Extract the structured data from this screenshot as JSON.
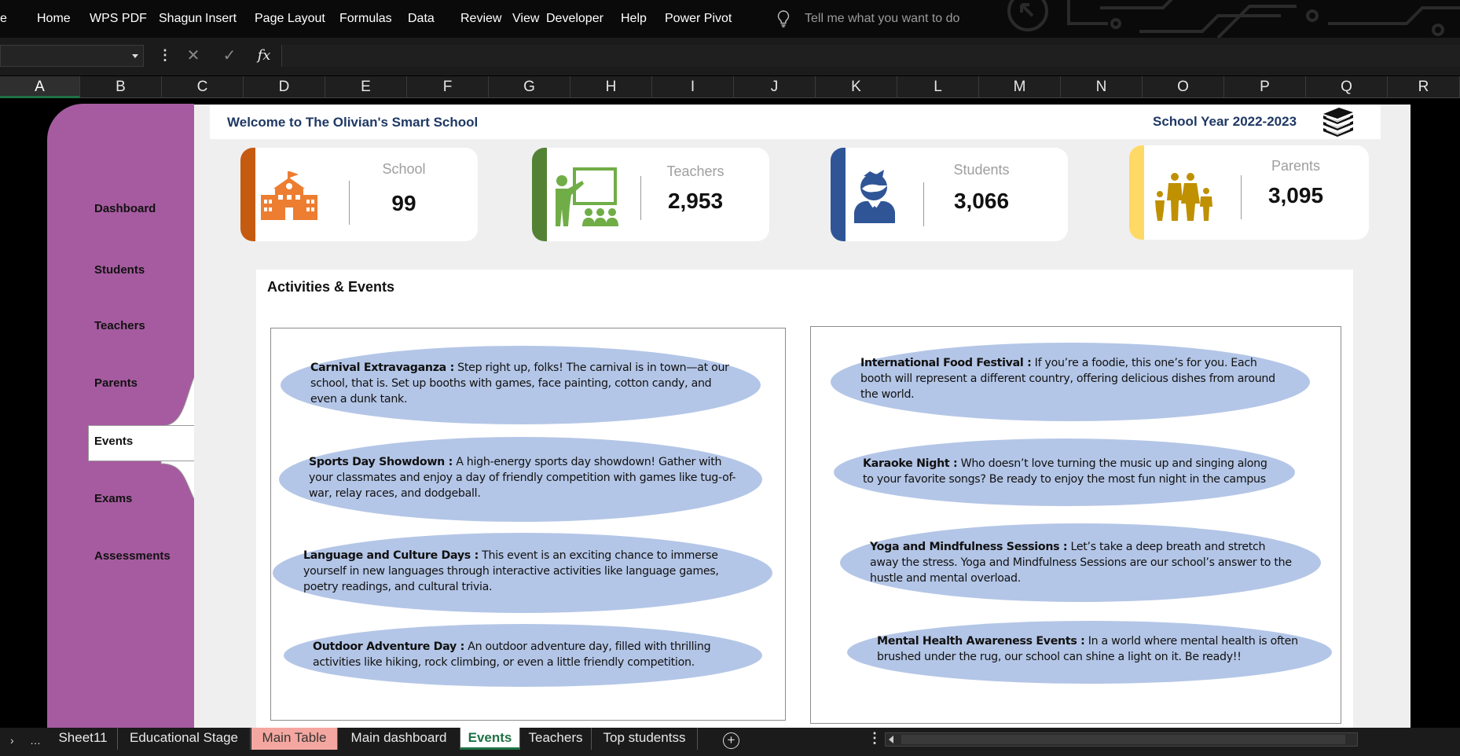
{
  "ribbon": {
    "menu": [
      "e",
      "Home",
      "WPS PDF",
      "Shagun",
      "Insert",
      "Page Layout",
      "Formulas",
      "Data",
      "Review",
      "View",
      "Developer",
      "Help",
      "Power Pivot"
    ],
    "tell_me": "Tell me what you want to do"
  },
  "formula_bar": {
    "cancel": "✕",
    "enter": "✓",
    "fx": "fx"
  },
  "columns": [
    "A",
    "B",
    "C",
    "D",
    "E",
    "F",
    "G",
    "H",
    "I",
    "J",
    "K",
    "L",
    "M",
    "N",
    "O",
    "P",
    "Q",
    "R"
  ],
  "selected_column": "A",
  "sidebar": {
    "items": [
      "Dashboard",
      "Students",
      "Teachers",
      "Parents",
      "Events",
      "Exams",
      "Assessments"
    ],
    "active": "Events"
  },
  "header": {
    "welcome": "Welcome to The Olivian's Smart School",
    "year": "School Year 2022-2023"
  },
  "cards": [
    {
      "label": "School",
      "value": "99",
      "color": "#c55a11",
      "icon": "school-building-icon"
    },
    {
      "label": "Teachers",
      "value": "2,953",
      "color": "#548235",
      "icon": "teacher-board-icon"
    },
    {
      "label": "Students",
      "value": "3,066",
      "color": "#2f5597",
      "icon": "student-icon"
    },
    {
      "label": "Parents",
      "value": "3,095",
      "color": "#ffd966",
      "icon": "family-icon"
    }
  ],
  "events": {
    "heading": "Activities & Events",
    "left": [
      {
        "title": "Carnival Extravaganza :",
        "text": " Step right up, folks! The carnival is in town—at our school, that is. Set up booths with games, face painting, cotton candy, and even a dunk tank."
      },
      {
        "title": "Sports Day Showdown :",
        "text": " A high-energy sports day showdown! Gather with your classmates and enjoy a day of friendly competition with games like tug-of-war, relay races, and dodgeball."
      },
      {
        "title": "Language and Culture Days :",
        "text": " This event is an exciting chance to immerse yourself in new languages through interactive activities like language games, poetry readings, and cultural trivia."
      },
      {
        "title": "Outdoor Adventure Day :",
        "text": " An outdoor adventure day, filled with thrilling activities like hiking, rock climbing, or even a little friendly competition."
      }
    ],
    "right": [
      {
        "title": "International Food Festival :",
        "text": " If you’re a foodie, this one’s for you. Each booth will represent a different country, offering delicious dishes from around the world."
      },
      {
        "title": "Karaoke Night :",
        "text": " Who doesn’t love turning the music up and singing along to your favorite songs? Be ready to enjoy the most fun night in the campus"
      },
      {
        "title": "Yoga and Mindfulness Sessions :",
        "text": " Let’s take a deep breath and stretch away the stress. Yoga and Mindfulness Sessions are our school’s answer to the hustle and mental overload."
      },
      {
        "title": "Mental Health Awareness Events :",
        "text": " In a world where mental health is often brushed under the rug, our school can shine a light on it. Be ready!!"
      }
    ]
  },
  "tabs": {
    "nav": [
      "›",
      "…"
    ],
    "items": [
      "Sheet11",
      "Educational Stage",
      "Main Table",
      "Main dashboard",
      "Events",
      "Teachers",
      "Top studentss"
    ],
    "active": "Events",
    "highlighted": "Main Table",
    "add": "+",
    "more": "⋮"
  }
}
